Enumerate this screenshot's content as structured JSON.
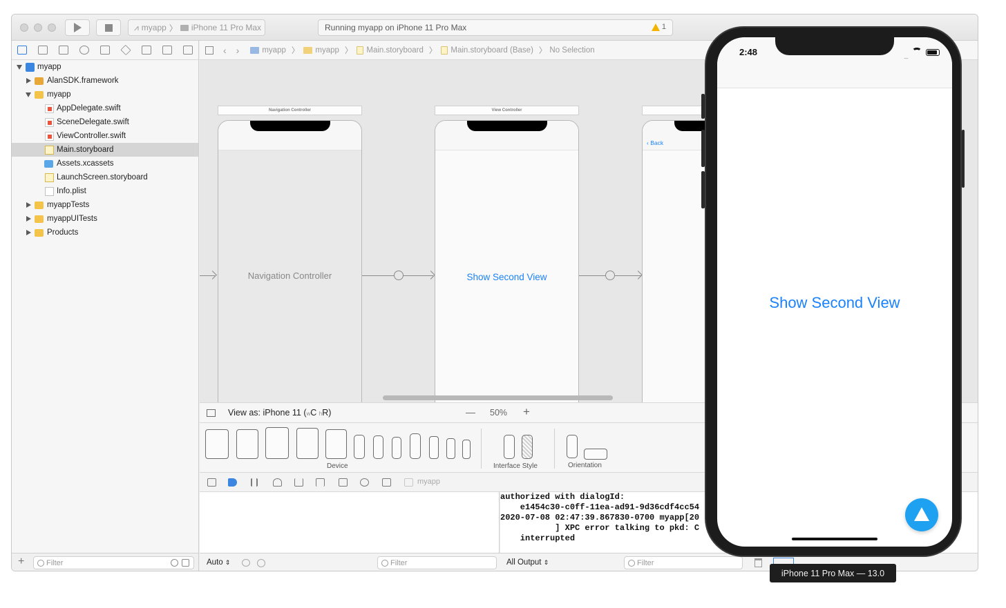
{
  "toolbar": {
    "scheme_target": "myapp",
    "scheme_device": "iPhone 11 Pro Max",
    "status": "Running myapp on iPhone 11 Pro Max",
    "warning_count": "1"
  },
  "navigator": {
    "items": [
      {
        "label": "myapp",
        "icon": "project-icon",
        "depth": 0,
        "expanded": true
      },
      {
        "label": "AlanSDK.framework",
        "icon": "framework-icon",
        "depth": 1,
        "expanded": false
      },
      {
        "label": "myapp",
        "icon": "folder-icon",
        "depth": 1,
        "expanded": true
      },
      {
        "label": "AppDelegate.swift",
        "icon": "swift-file-icon",
        "depth": 2
      },
      {
        "label": "SceneDelegate.swift",
        "icon": "swift-file-icon",
        "depth": 2
      },
      {
        "label": "ViewController.swift",
        "icon": "swift-file-icon",
        "depth": 2
      },
      {
        "label": "Main.storyboard",
        "icon": "storyboard-file-icon",
        "depth": 2,
        "selected": true
      },
      {
        "label": "Assets.xcassets",
        "icon": "assets-icon",
        "depth": 2
      },
      {
        "label": "LaunchScreen.storyboard",
        "icon": "storyboard-file-icon",
        "depth": 2
      },
      {
        "label": "Info.plist",
        "icon": "plist-file-icon",
        "depth": 2
      },
      {
        "label": "myappTests",
        "icon": "folder-icon",
        "depth": 1,
        "expanded": false
      },
      {
        "label": "myappUITests",
        "icon": "folder-icon",
        "depth": 1,
        "expanded": false
      },
      {
        "label": "Products",
        "icon": "folder-icon",
        "depth": 1,
        "expanded": false
      }
    ],
    "filter_placeholder": "Filter"
  },
  "jumpbar": {
    "crumbs": [
      "myapp",
      "myapp",
      "Main.storyboard",
      "Main.storyboard (Base)",
      "No Selection"
    ]
  },
  "canvas": {
    "scenes": [
      {
        "title": "Navigation Controller",
        "label": "Navigation Controller"
      },
      {
        "title": "View Controller",
        "button": "Show Second View"
      },
      {
        "back_label": "Back"
      }
    ]
  },
  "view_as": {
    "label": "View as: iPhone 11 (",
    "w": "w",
    "c": "C",
    "h": "h",
    "r": "R)",
    "zoom": "50%",
    "minus": "—",
    "plus": "+"
  },
  "device_panel": {
    "device_caption": "Device",
    "style_caption": "Interface Style",
    "orientation_caption": "Orientation"
  },
  "debug": {
    "target": "myapp",
    "auto_label": "Auto",
    "filter_placeholder": "Filter",
    "output_label": "All Output",
    "console_lines": "authorized with dialogId:\n    e1454c30-c0ff-11ea-ad91-9d36cdf4cc54\n2020-07-08 02:47:39.867830-0700 myapp[20\n           ] XPC error talking to pkd: C\n    interrupted"
  },
  "simulator": {
    "time": "2:48",
    "button": "Show Second View",
    "tooltip": "iPhone 11 Pro Max — 13.0"
  },
  "colors": {
    "ios_blue": "#1a82fb",
    "selection": "#d5d5d5",
    "alan_button": "#1ea1f0"
  }
}
